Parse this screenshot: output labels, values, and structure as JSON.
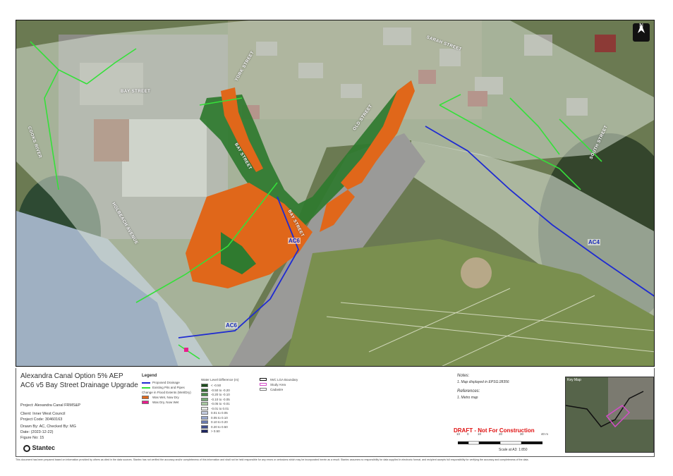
{
  "map": {
    "street_labels": {
      "york": "YORK STREET",
      "bay_top": "BAY STREET",
      "sarah": "SARAH STREET",
      "old": "OLD STREET",
      "bay_mid": "BAY STREET",
      "bay_lower": "BAY STREET",
      "south": "SOUTH STREET",
      "holbeach": "HOLBEACH AVENUE",
      "cooks": "COOKS RIVER"
    },
    "line_labels": {
      "ac6_upper": "AC6",
      "ac6_lower": "AC6",
      "ac4": "AC4"
    },
    "north_arrow": "N",
    "colors": {
      "green_depth": "#2f7a2f",
      "orange_new_dry": "#e0671a",
      "proposed_drainage": "#1f2bd1",
      "existing_pits": "#35e03a"
    }
  },
  "title": {
    "line1": "Alexandra Canal Option 5% AEP",
    "line2": "AC6 v5 Bay Street Drainage Upgrade"
  },
  "info": {
    "project": "Project: Alexandra Canal FRMS&P",
    "client": "Client:  Inner West Council",
    "code": "Project Code:  30460163",
    "drawn": "Drawn By:  AC, Checked By: MG",
    "date": "Date:  (2023-12-22)",
    "figure": "Figure No:  15"
  },
  "legend": {
    "title": "Legend",
    "proposed": "Proposed Drainage",
    "existing": "Existing Pits and Pipes",
    "change_header": "Change in Flood Extents (Wet/Dry)",
    "was_wet": "Was Wet, Now Dry",
    "was_dry": "Was Dry, Now Wet",
    "wl_header": "Water Level Difference (m)",
    "wl_items": [
      "< -0.50",
      "-0.50 to -0.20",
      "-0.20 to -0.10",
      "-0.10 to -0.05",
      "-0.05 to -0.01",
      "-0.01 to 0.01",
      "0.01 to 0.05",
      "0.05 to 0.10",
      "0.10 to 0.20",
      "0.20 to 0.50",
      "> 0.50"
    ],
    "wl_colors": [
      "#1d4d1d",
      "#2f6a2f",
      "#4b8a4b",
      "#73a873",
      "#a8c8a0",
      "#e8eae6",
      "#c4cce0",
      "#97a6cc",
      "#6a7ab0",
      "#3f4e8e",
      "#1c2460"
    ],
    "lga": "IWC LGA Boundary",
    "study": "Study Area",
    "cadastre": "Cadastre"
  },
  "notes": {
    "heading": "Notes:",
    "text": "1. Map displayed in EPSG:28356",
    "ref_heading": "References:",
    "ref_text": "1. Metro map"
  },
  "draft": "DRAFT - Not For Construction",
  "scale": {
    "ticks": [
      "10",
      "0",
      "10",
      "20",
      "30",
      "40 m"
    ],
    "text": "Scale at A3: 1:850"
  },
  "keymap": {
    "label": "Key Map"
  },
  "logo": "Stantec",
  "disclaimer": "This document has been prepared based on information provided by others as cited in the data sources. Stantec has not verified the accuracy and/or completeness of this information and shall not be held responsible for any errors or omissions which may be incorporated herein as a result. Stantec assumes no responsibility for data supplied in electronic format, and recipient accepts full responsibility for verifying the accuracy and completeness of the data."
}
